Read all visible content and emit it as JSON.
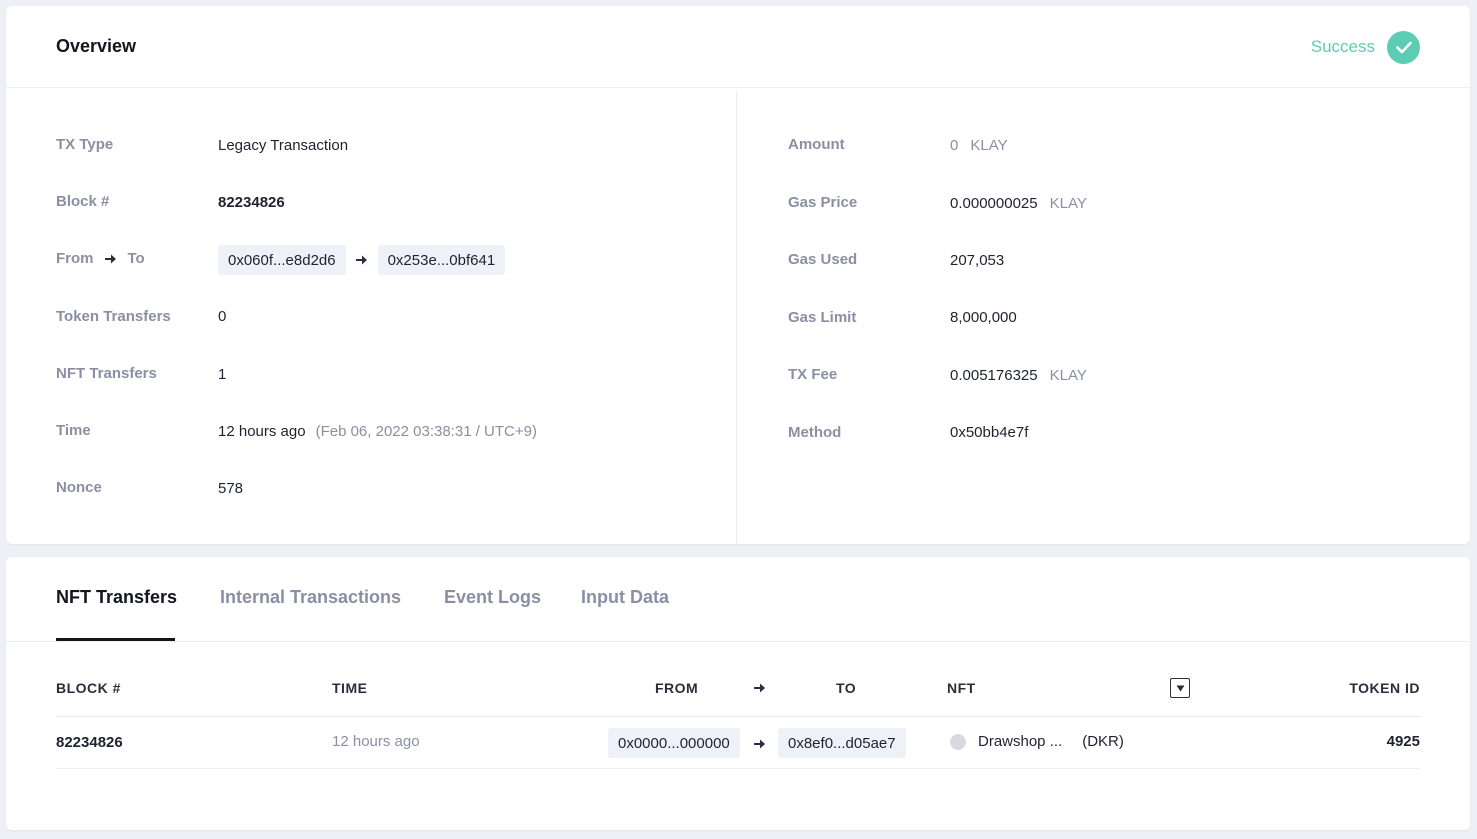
{
  "overview": {
    "title": "Overview",
    "status": "Success",
    "left": {
      "tx_type": {
        "label": "TX Type",
        "value": "Legacy Transaction"
      },
      "block": {
        "label": "Block #",
        "value": "82234826"
      },
      "from_to": {
        "label_from": "From",
        "label_to": "To",
        "from": "0x060f...e8d2d6",
        "to": "0x253e...0bf641"
      },
      "token_transfers": {
        "label": "Token Transfers",
        "value": "0"
      },
      "nft_transfers": {
        "label": "NFT Transfers",
        "value": "1"
      },
      "time": {
        "label": "Time",
        "value": "12 hours ago",
        "detail": "(Feb 06, 2022 03:38:31 / UTC+9)"
      },
      "nonce": {
        "label": "Nonce",
        "value": "578"
      }
    },
    "right": {
      "amount": {
        "label": "Amount",
        "value": "0",
        "unit": "KLAY"
      },
      "gas_price": {
        "label": "Gas Price",
        "value": "0.000000025",
        "unit": "KLAY"
      },
      "gas_used": {
        "label": "Gas Used",
        "value": "207,053"
      },
      "gas_limit": {
        "label": "Gas Limit",
        "value": "8,000,000"
      },
      "tx_fee": {
        "label": "TX Fee",
        "value": "0.005176325",
        "unit": "KLAY"
      },
      "method": {
        "label": "Method",
        "value": "0x50bb4e7f"
      }
    }
  },
  "tabs": [
    {
      "label": "NFT Transfers",
      "active": true
    },
    {
      "label": "Internal Transactions",
      "active": false
    },
    {
      "label": "Event Logs",
      "active": false
    },
    {
      "label": "Input Data",
      "active": false
    }
  ],
  "nft_table": {
    "headers": {
      "block": "BLOCK #",
      "time": "TIME",
      "from": "FROM",
      "to": "TO",
      "nft": "NFT",
      "token_id": "TOKEN ID"
    },
    "rows": [
      {
        "block": "82234826",
        "time": "12 hours ago",
        "from": "0x0000...000000",
        "to": "0x8ef0...d05ae7",
        "nft_name": "Drawshop ...",
        "nft_symbol": "(DKR)",
        "token_id": "4925"
      }
    ]
  },
  "colors": {
    "success": "#5ccdb4",
    "label": "#8a8fa3",
    "chip_bg": "#eff1f8"
  },
  "icons": [
    "check-icon",
    "arrow-right-icon",
    "filter-dropdown-icon",
    "nft-thumbnail-icon"
  ]
}
